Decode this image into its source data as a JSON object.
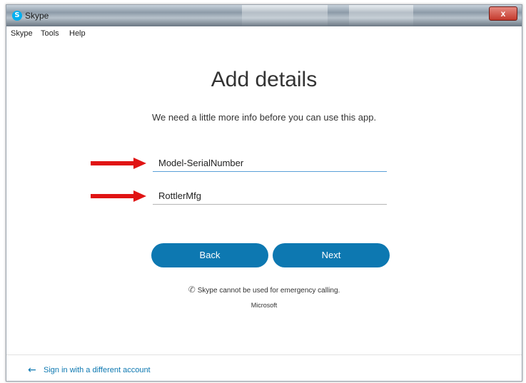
{
  "window": {
    "title": "Skype",
    "app_icon_letter": "S",
    "close_glyph": "x"
  },
  "menu": {
    "items": [
      "Skype",
      "Tools",
      "Help"
    ]
  },
  "main": {
    "heading": "Add details",
    "subtext": "We need a little more info before you can use this app.",
    "fields": [
      {
        "value": "Model-SerialNumber"
      },
      {
        "value": "RottlerMfg"
      }
    ],
    "buttons": {
      "back": "Back",
      "next": "Next"
    },
    "notice": "Skype cannot be used for emergency calling.",
    "company": "Microsoft"
  },
  "footer": {
    "signin_link": "Sign in with a different account"
  },
  "colors": {
    "accent": "#0d78b1",
    "arrow": "#e01414",
    "field_active_underline": "#5aa0d8"
  },
  "icons": {
    "app": "skype-icon",
    "close": "close-icon",
    "phone": "no-phone-icon",
    "back": "back-arrow-icon",
    "annotation": "red-arrow-icon"
  }
}
